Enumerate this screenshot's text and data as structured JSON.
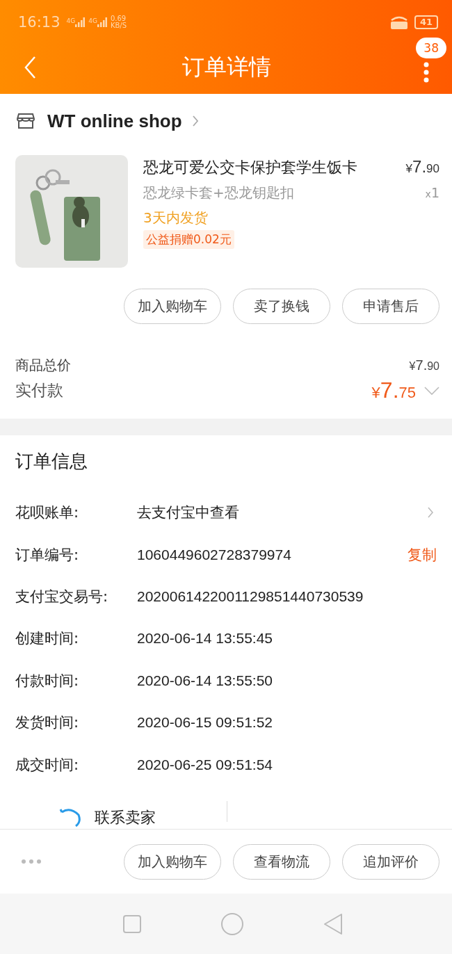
{
  "status_bar": {
    "time": "16:13",
    "network_1": "4G",
    "network_2": "4G",
    "speed_value": "0.69",
    "speed_unit": "KB/S",
    "battery": "41"
  },
  "nav": {
    "title": "订单详情",
    "badge": "38"
  },
  "shop": {
    "name": "WT online shop"
  },
  "item": {
    "kind": "picture",
    "title": "恐龙可爱公交卡保护套学生饭卡",
    "sku": "恐龙绿卡套+恐龙钥匙扣",
    "shipping": "3天内发货",
    "donation": "公益捐赠0.02元",
    "price": {
      "symbol": "¥",
      "int": "7.",
      "dec": "90"
    },
    "quantity_mark": "x",
    "quantity": "1"
  },
  "item_actions": [
    "加入购物车",
    "卖了换钱",
    "申请售后"
  ],
  "totals": [
    {
      "label": "商品总价",
      "price": {
        "symbol": "¥",
        "int": "7.",
        "dec": "90"
      },
      "kind": "plain"
    },
    {
      "label": "实付款",
      "price": {
        "symbol": "¥",
        "int": "7.",
        "dec": "75"
      },
      "kind": "paid"
    }
  ],
  "order_info": {
    "title": "订单信息",
    "rows": [
      {
        "label": "花呗账单:",
        "value": "去支付宝中查看",
        "kind": "link"
      },
      {
        "label": "订单编号:",
        "value": "1060449602728379974",
        "action": "复制",
        "kind": "copy"
      },
      {
        "label": "支付宝交易号:",
        "value": "2020061422001129851440730539",
        "kind": "plain"
      },
      {
        "label": "创建时间:",
        "value": "2020-06-14 13:55:45",
        "kind": "plain"
      },
      {
        "label": "付款时间:",
        "value": "2020-06-14 13:55:50",
        "kind": "plain"
      },
      {
        "label": "发货时间:",
        "value": "2020-06-15 09:51:52",
        "kind": "plain"
      },
      {
        "label": "成交时间:",
        "value": "2020-06-25 09:51:54",
        "kind": "plain"
      }
    ]
  },
  "contact": {
    "label": "联系卖家"
  },
  "bottom_actions": [
    "加入购物车",
    "查看物流",
    "追加评价"
  ]
}
